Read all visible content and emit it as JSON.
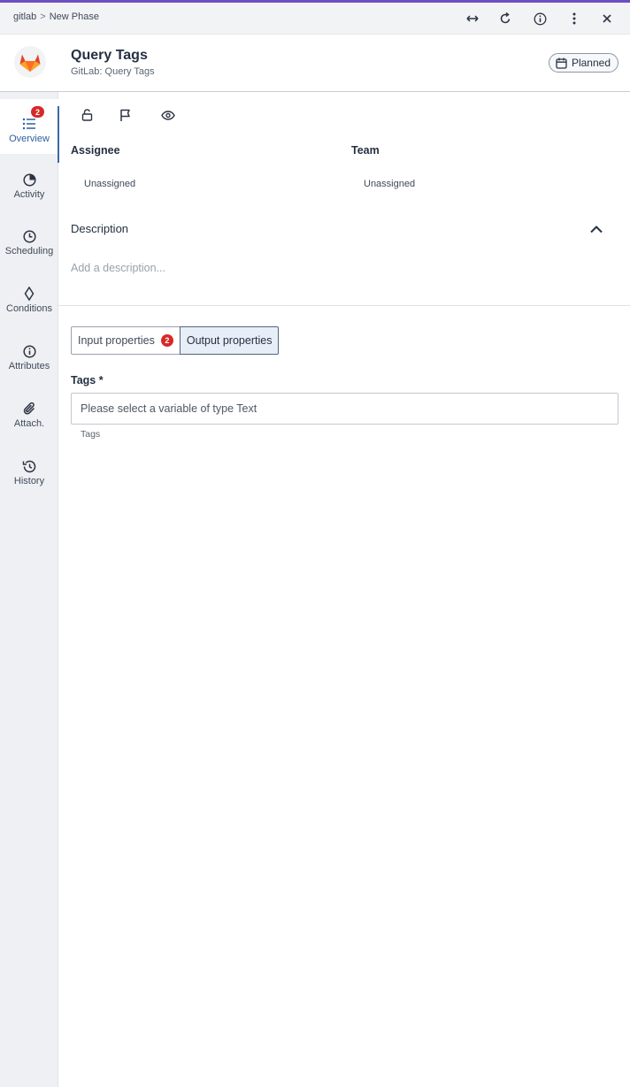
{
  "colors": {
    "accent": "#6c4fc2",
    "badge": "#d62929",
    "active_nav": "#3d68a8"
  },
  "breadcrumb": {
    "root": "gitlab",
    "separator": ">",
    "current": "New Phase"
  },
  "window_actions": [
    "expand-horizontal-icon",
    "refresh-icon",
    "info-icon",
    "more-vertical-icon",
    "close-icon"
  ],
  "header": {
    "logo": "gitlab-logo",
    "title": "Query Tags",
    "subtitle": "GitLab: Query Tags",
    "status": {
      "label": "Planned",
      "icon": "calendar-icon"
    }
  },
  "sidebar": {
    "items": [
      {
        "label": "Overview",
        "icon": "list-icon",
        "badge": "2",
        "active": true
      },
      {
        "label": "Activity",
        "icon": "pie-icon"
      },
      {
        "label": "Scheduling",
        "icon": "clock-icon"
      },
      {
        "label": "Conditions",
        "icon": "diamond-icon"
      },
      {
        "label": "Attributes",
        "icon": "info-icon"
      },
      {
        "label": "Attach.",
        "icon": "paperclip-icon"
      },
      {
        "label": "History",
        "icon": "history-icon"
      }
    ]
  },
  "toolbar": [
    "unlock-icon",
    "flag-icon",
    "eye-icon"
  ],
  "fields": {
    "assignee": {
      "label": "Assignee",
      "value": "Unassigned"
    },
    "team": {
      "label": "Team",
      "value": "Unassigned"
    }
  },
  "description": {
    "label": "Description",
    "placeholder": "Add a description..."
  },
  "tabs": [
    {
      "label": "Input properties",
      "badge": "2"
    },
    {
      "label": "Output properties",
      "active": true
    }
  ],
  "tags": {
    "label": "Tags *",
    "placeholder": "Please select a variable of type Text",
    "help": "Tags"
  }
}
